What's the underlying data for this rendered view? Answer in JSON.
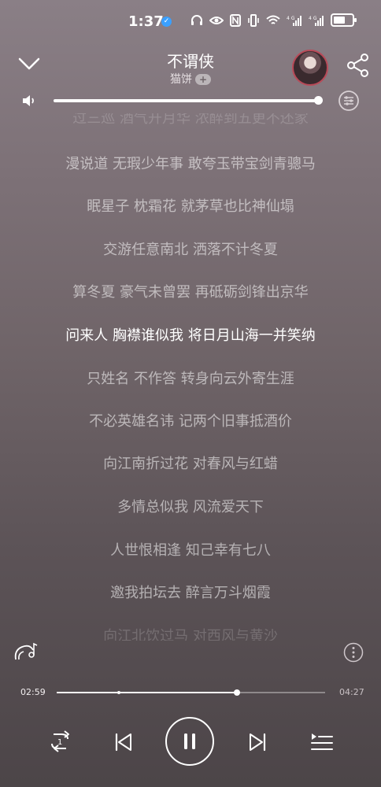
{
  "status_bar": {
    "time": "1:37",
    "icons": [
      "headphones-icon",
      "eye-icon",
      "nfc-icon",
      "vibrate-icon",
      "wifi-icon",
      "signal-4g-icon",
      "signal-4g-icon",
      "battery-icon"
    ]
  },
  "header": {
    "title": "不谓侠",
    "artist": "猫饼",
    "follow_label": "+"
  },
  "lyrics": {
    "lines": [
      "过三巡 酒气开月华 浓醉到五更不还家",
      "漫说道 无瑕少年事 敢夸玉带宝剑青骢马",
      "眠星子 枕霜花 就茅草也比神仙塌",
      "交游任意南北 洒落不计冬夏",
      "算冬夏 豪气未曾罢 再砥砺剑锋出京华",
      "问来人 胸襟谁似我 将日月山海一并笑纳",
      "只姓名 不作答 转身向云外寄生涯",
      "不必英雄名讳 记两个旧事抵酒价",
      "向江南折过花 对春风与红蜡",
      "多情总似我 风流爱天下",
      "人世恨相逢 知己幸有七八",
      "邀我拍坛去 醉言万斗烟霞",
      "向江北饮过马 对西风与黄沙"
    ],
    "current_index": 5
  },
  "player": {
    "elapsed": "02:59",
    "total": "04:27",
    "progress": 0.6704,
    "volume": 1.0,
    "repeat_badge": "1"
  },
  "colors": {
    "accent": "#ffffff",
    "avatar_ring": "#b84a58"
  }
}
